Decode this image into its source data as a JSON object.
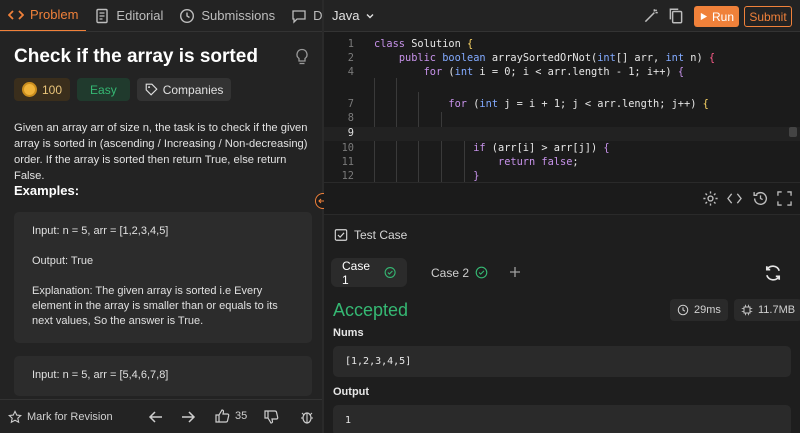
{
  "tabs": [
    {
      "label": "Problem"
    },
    {
      "label": "Editorial"
    },
    {
      "label": "Submissions"
    },
    {
      "label": "Discu"
    }
  ],
  "problem": {
    "title": "Check if the array is sorted",
    "coins": "100",
    "difficulty": "Easy",
    "companies": "Companies",
    "description": "Given an array arr of size n, the task is to check if the given array is sorted in (ascending / Increasing / Non-decreasing) order. If the array is sorted then return True, else return False.",
    "examples_heading": "Examples:",
    "example1": {
      "input": "Input: n = 5, arr = [1,2,3,4,5]",
      "output": "Output: True",
      "explanation": "Explanation: The given array is sorted i.e Every element in the array is smaller than or equals to its next values, So the answer is True."
    },
    "example2": {
      "input": "Input: n = 5, arr = [5,4,6,7,8]"
    }
  },
  "bottom": {
    "mark": "Mark for Revision",
    "likes": "35"
  },
  "editor": {
    "language": "Java",
    "run": "Run",
    "submit": "Submit",
    "line_numbers": [
      "1",
      "2",
      "4",
      "7",
      "8",
      "9",
      "10",
      "11",
      "12"
    ]
  },
  "testcase": {
    "heading": "Test Case",
    "cases": [
      "Case 1",
      "Case 2"
    ],
    "status": "Accepted",
    "runtime": "29ms",
    "memory": "11.7MB",
    "input_label": "Nums",
    "input_value": "[1,2,3,4,5]",
    "output_label": "Output",
    "output_value": "1"
  },
  "colors": {
    "accent": "#f0813a",
    "success": "#35b873"
  }
}
